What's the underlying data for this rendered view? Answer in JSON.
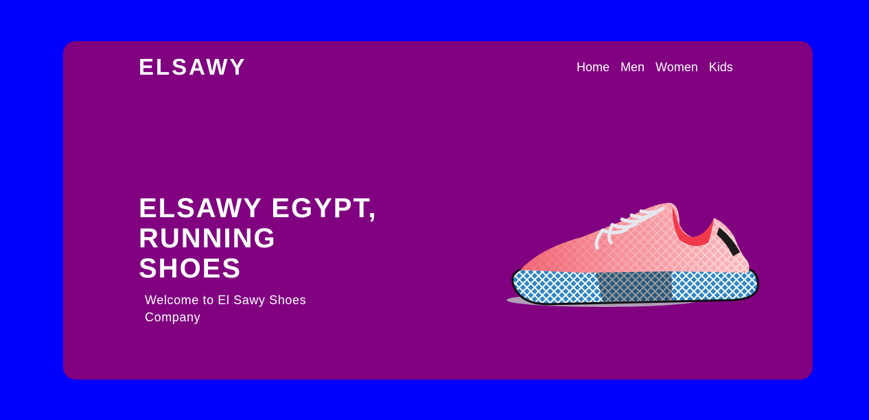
{
  "brand": {
    "logo": "ELSAWY"
  },
  "nav": {
    "items": [
      "Home",
      "Men",
      "Women",
      "Kids"
    ]
  },
  "hero": {
    "title_lines": [
      "ELSAWY EGYPT,",
      "RUNNING",
      "SHOES"
    ],
    "subtitle": "Welcome to El Sawy Shoes Company",
    "image": "running-shoe-image"
  },
  "colors": {
    "background": "#0000ff",
    "card": "#800080",
    "text": "#ffffff",
    "shoe_upper": "#f25a6a",
    "shoe_sole": "#2f86c8"
  }
}
